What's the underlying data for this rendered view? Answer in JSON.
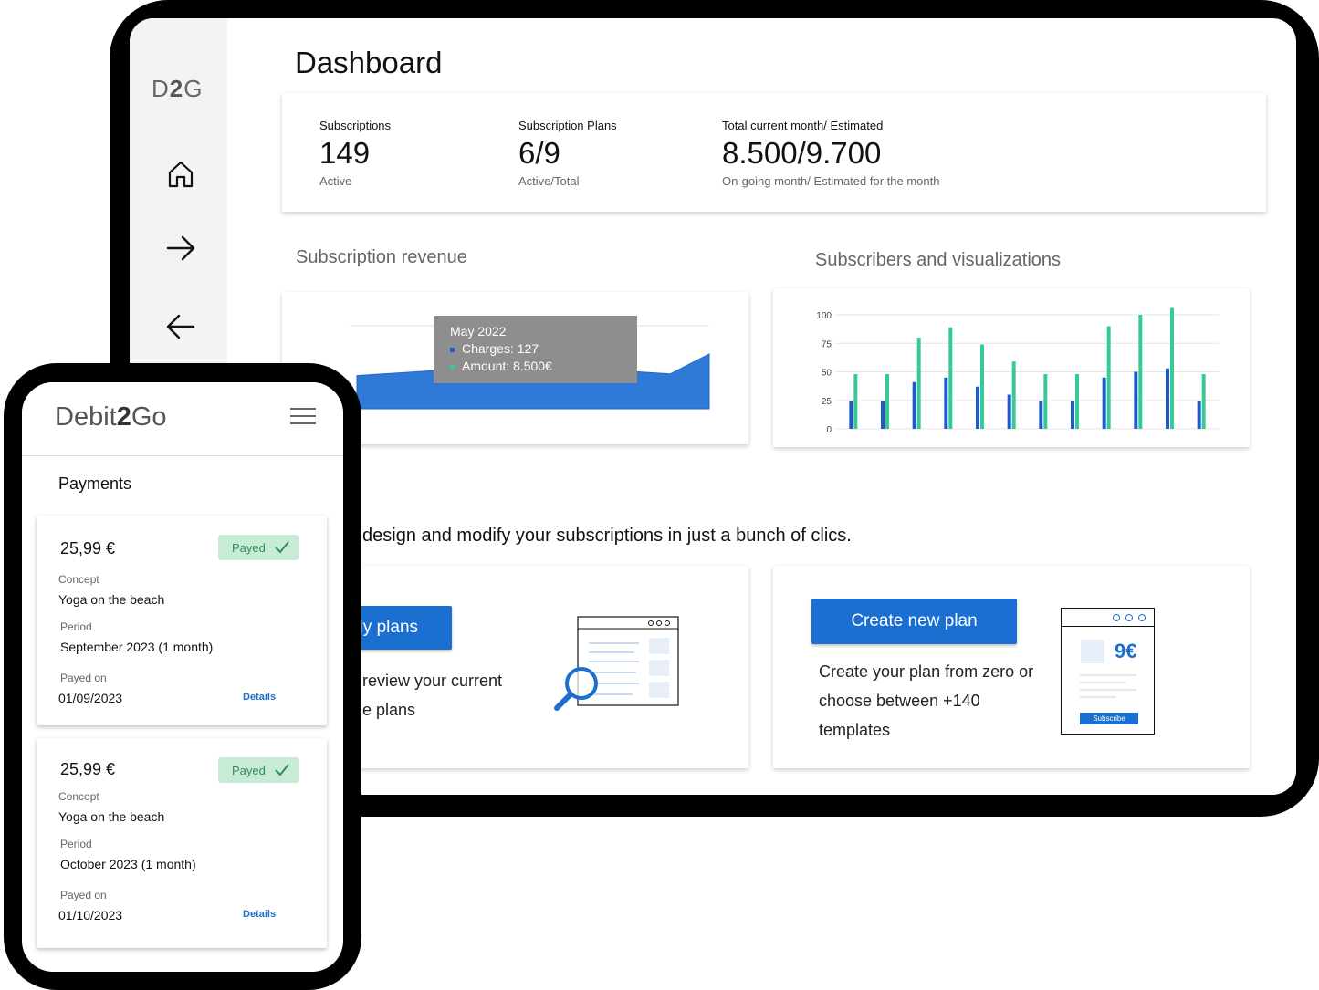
{
  "tablet": {
    "logo": {
      "pre": "D",
      "bold": "2",
      "post": "G"
    },
    "page_title": "Dashboard",
    "nav_icons": [
      "home-icon",
      "arrow-right-icon",
      "arrow-left-icon"
    ],
    "stats": [
      {
        "label": "Subscriptions",
        "value": "149",
        "sub": "Active"
      },
      {
        "label": "Subscription Plans",
        "value": "6/9",
        "sub": "Active/Total"
      },
      {
        "label": "Total current month/ Estimated",
        "value": "8.500/9.700",
        "sub": "On-going month/ Estimated for the month"
      }
    ],
    "revenue_title": "Subscription revenue",
    "visual_title": "Subscribers and visualizations",
    "tooltip": {
      "title": "May 2022",
      "line1": "Charges: 127",
      "line2": "Amount: 8.500€"
    },
    "tagline": "design and modify your subscriptions in just a bunch of clics.",
    "my_plans": {
      "button": "My plans",
      "text1": "review your current",
      "text2": "e plans"
    },
    "create_plan": {
      "button": "Create new plan",
      "text1": "Create your plan from zero or",
      "text2": "choose between +140",
      "text3": "templates",
      "price": "9€",
      "subscribe": "Subscribe"
    }
  },
  "chart_data": [
    {
      "type": "area",
      "title": "Subscription revenue",
      "series": [
        {
          "values": [
            40,
            43,
            46,
            60,
            63,
            58,
            54,
            45,
            42,
            66
          ]
        }
      ],
      "ylim": [
        0,
        100
      ],
      "grid": true,
      "color": "#2f7ad6"
    },
    {
      "type": "bar",
      "title": "Subscribers and visualizations",
      "yticks": [
        "100",
        "75",
        "50",
        "25",
        "0"
      ],
      "ylim": [
        0,
        100
      ],
      "series": [
        {
          "values": [
            24,
            24,
            41,
            45,
            37,
            30,
            24,
            24,
            45,
            50,
            53,
            24
          ],
          "color": "#1b5cc8"
        },
        {
          "values": [
            48,
            48,
            80,
            89,
            74,
            59,
            48,
            48,
            90,
            100,
            106,
            48
          ],
          "color": "#36c99a"
        }
      ],
      "grid": true
    }
  ],
  "phone": {
    "brand": {
      "pre": "Debit",
      "bold": "2",
      "post": "Go"
    },
    "title": "Payments",
    "payments": [
      {
        "amount": "25,99 €",
        "status": "Payed",
        "concept_label": "Concept",
        "concept": "Yoga on the beach",
        "period_label": "Period",
        "period": "September 2023 (1 month)",
        "payed_label": "Payed on",
        "payed_on": "01/09/2023",
        "details": "Details"
      },
      {
        "amount": "25,99 €",
        "status": "Payed",
        "concept_label": "Concept",
        "concept": "Yoga on the beach",
        "period_label": "Period",
        "period": "October 2023 (1 month)",
        "payed_label": "Payed on",
        "payed_on": "01/10/2023",
        "details": "Details"
      }
    ]
  }
}
